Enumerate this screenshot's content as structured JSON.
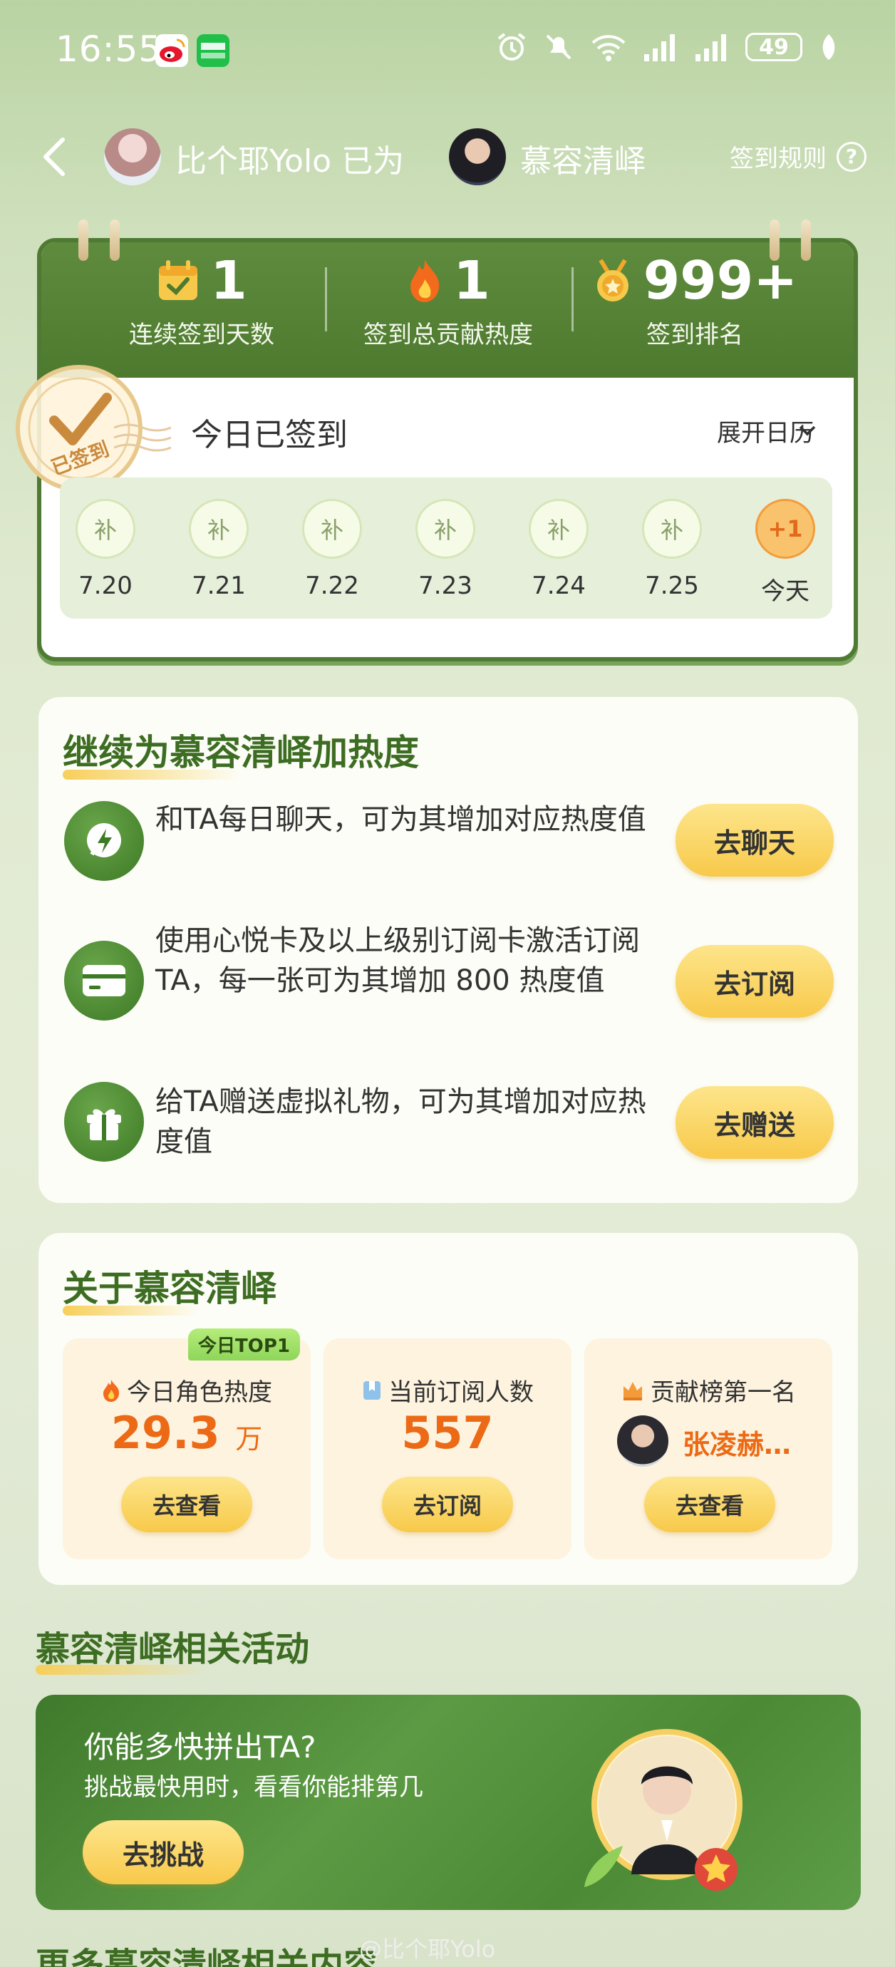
{
  "status_bar": {
    "time": "16:55",
    "battery": "49",
    "app_icons": [
      "weibo-icon",
      "iqiyi-icon"
    ],
    "system_icons": [
      "alarm-icon",
      "mute-icon",
      "wifi-icon",
      "signal-icon",
      "signal-icon",
      "leaf-icon"
    ]
  },
  "header": {
    "user_name": "比个耶Yolo 已为",
    "character_name": "慕容清峄",
    "rules_label": "签到规则",
    "help_icon": "?"
  },
  "stats": {
    "streak_value": "1",
    "streak_label": "连续签到天数",
    "heat_value": "1",
    "heat_label": "签到总贡献热度",
    "rank_value": "999+",
    "rank_label": "签到排名"
  },
  "signin": {
    "stamp_text": "已签到",
    "status": "今日已签到",
    "expand_label": "展开日历",
    "days": [
      {
        "mark": "补",
        "date": "7.20"
      },
      {
        "mark": "补",
        "date": "7.21"
      },
      {
        "mark": "补",
        "date": "7.22"
      },
      {
        "mark": "补",
        "date": "7.23"
      },
      {
        "mark": "补",
        "date": "7.24"
      },
      {
        "mark": "补",
        "date": "7.25"
      },
      {
        "mark": "+1",
        "date": "今天"
      }
    ]
  },
  "boost": {
    "title": "继续为慕容清峄加热度",
    "tasks": [
      {
        "text": "和TA每日聊天，可为其增加对应热度值",
        "button": "去聊天",
        "icon": "chat-bolt-icon"
      },
      {
        "text": "使用心悦卡及以上级别订阅卡激活订阅TA，每一张可为其增加 800 热度值",
        "button": "去订阅",
        "icon": "card-icon"
      },
      {
        "text": "给TA赠送虚拟礼物，可为其增加对应热度值",
        "button": "去赠送",
        "icon": "gift-icon"
      }
    ]
  },
  "about": {
    "title": "关于慕容清峄",
    "tiles": [
      {
        "badge": "今日TOP1",
        "title": "今日角色热度",
        "value": "29.3",
        "unit": "万",
        "button": "去查看",
        "icon": "fire-icon"
      },
      {
        "title": "当前订阅人数",
        "value": "557",
        "button": "去订阅",
        "icon": "bookmark-icon"
      },
      {
        "title": "贡献榜第一名",
        "value": "张凌赫…",
        "button": "去查看",
        "icon": "crown-fire-icon"
      }
    ]
  },
  "activities": {
    "title": "慕容清峄相关活动",
    "banner_title": "你能多快拼出TA?",
    "banner_sub": "挑战最快用时，看看你能排第几",
    "banner_button": "去挑战"
  },
  "footer": {
    "partial_title": "更多慕容清峄相关内容",
    "watermark": "@比个耶Yolo"
  }
}
